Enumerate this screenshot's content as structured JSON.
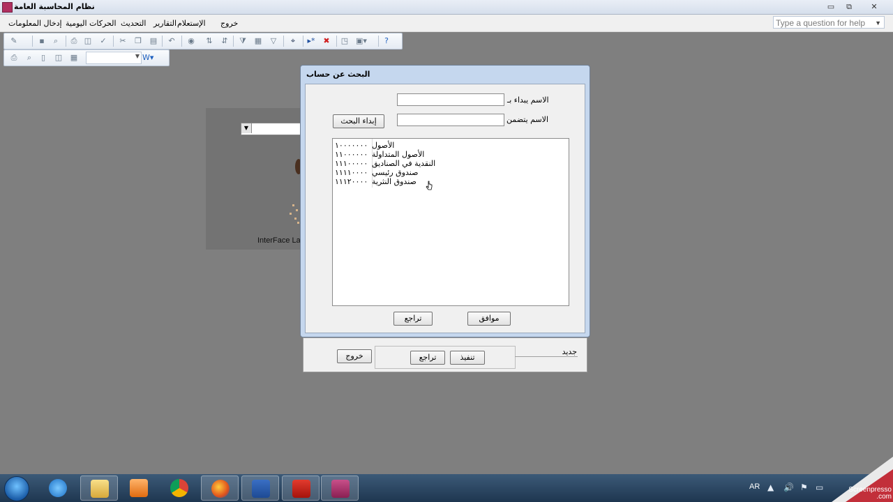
{
  "window": {
    "title": "نظام المحاسبة العامة",
    "controls": {
      "minimize": "▭",
      "restore": "⧉",
      "close": "✕"
    }
  },
  "menu": {
    "items": [
      "خروج",
      "الإستعلام",
      "التقارير",
      "التحديث",
      "الحركات اليومية",
      "إدخال المعلومات"
    ],
    "help_placeholder": "Type a question for help"
  },
  "background_form": {
    "label": "InterFace Lan"
  },
  "bottom_panel": {
    "exit_label": "خروج",
    "undo_label": "تراجع",
    "execute_label": "تنفيذ",
    "new_label": "جديد"
  },
  "dialog": {
    "title": "البحث عن حساب",
    "starts_with_label": "الاسم يبداء بـ",
    "contains_label": "الاسم يتضمن",
    "start_search_label": "إبداء البحث",
    "results": [
      {
        "code": "١٠٠٠٠٠٠٠",
        "name": "الأصول"
      },
      {
        "code": "١١٠٠٠٠٠٠",
        "name": "الأصول المتداولة"
      },
      {
        "code": "١١١٠٠٠٠٠",
        "name": "النقدية في الصناديق"
      },
      {
        "code": "١١١١٠٠٠٠",
        "name": "صندوق رئيسي"
      },
      {
        "code": "١١١٢٠٠٠٠",
        "name": "صندوق النثرية"
      }
    ],
    "ok_label": "موافق",
    "cancel_label": "تراجع"
  },
  "taskbar": {
    "language": "AR",
    "apps": [
      "internet-explorer-icon",
      "file-explorer-icon",
      "media-player-icon",
      "chrome-icon",
      "firefox-icon",
      "word-icon",
      "acrobat-icon",
      "access-icon"
    ]
  },
  "watermark": {
    "line1": "Screenpresso",
    "line2": ".com"
  }
}
